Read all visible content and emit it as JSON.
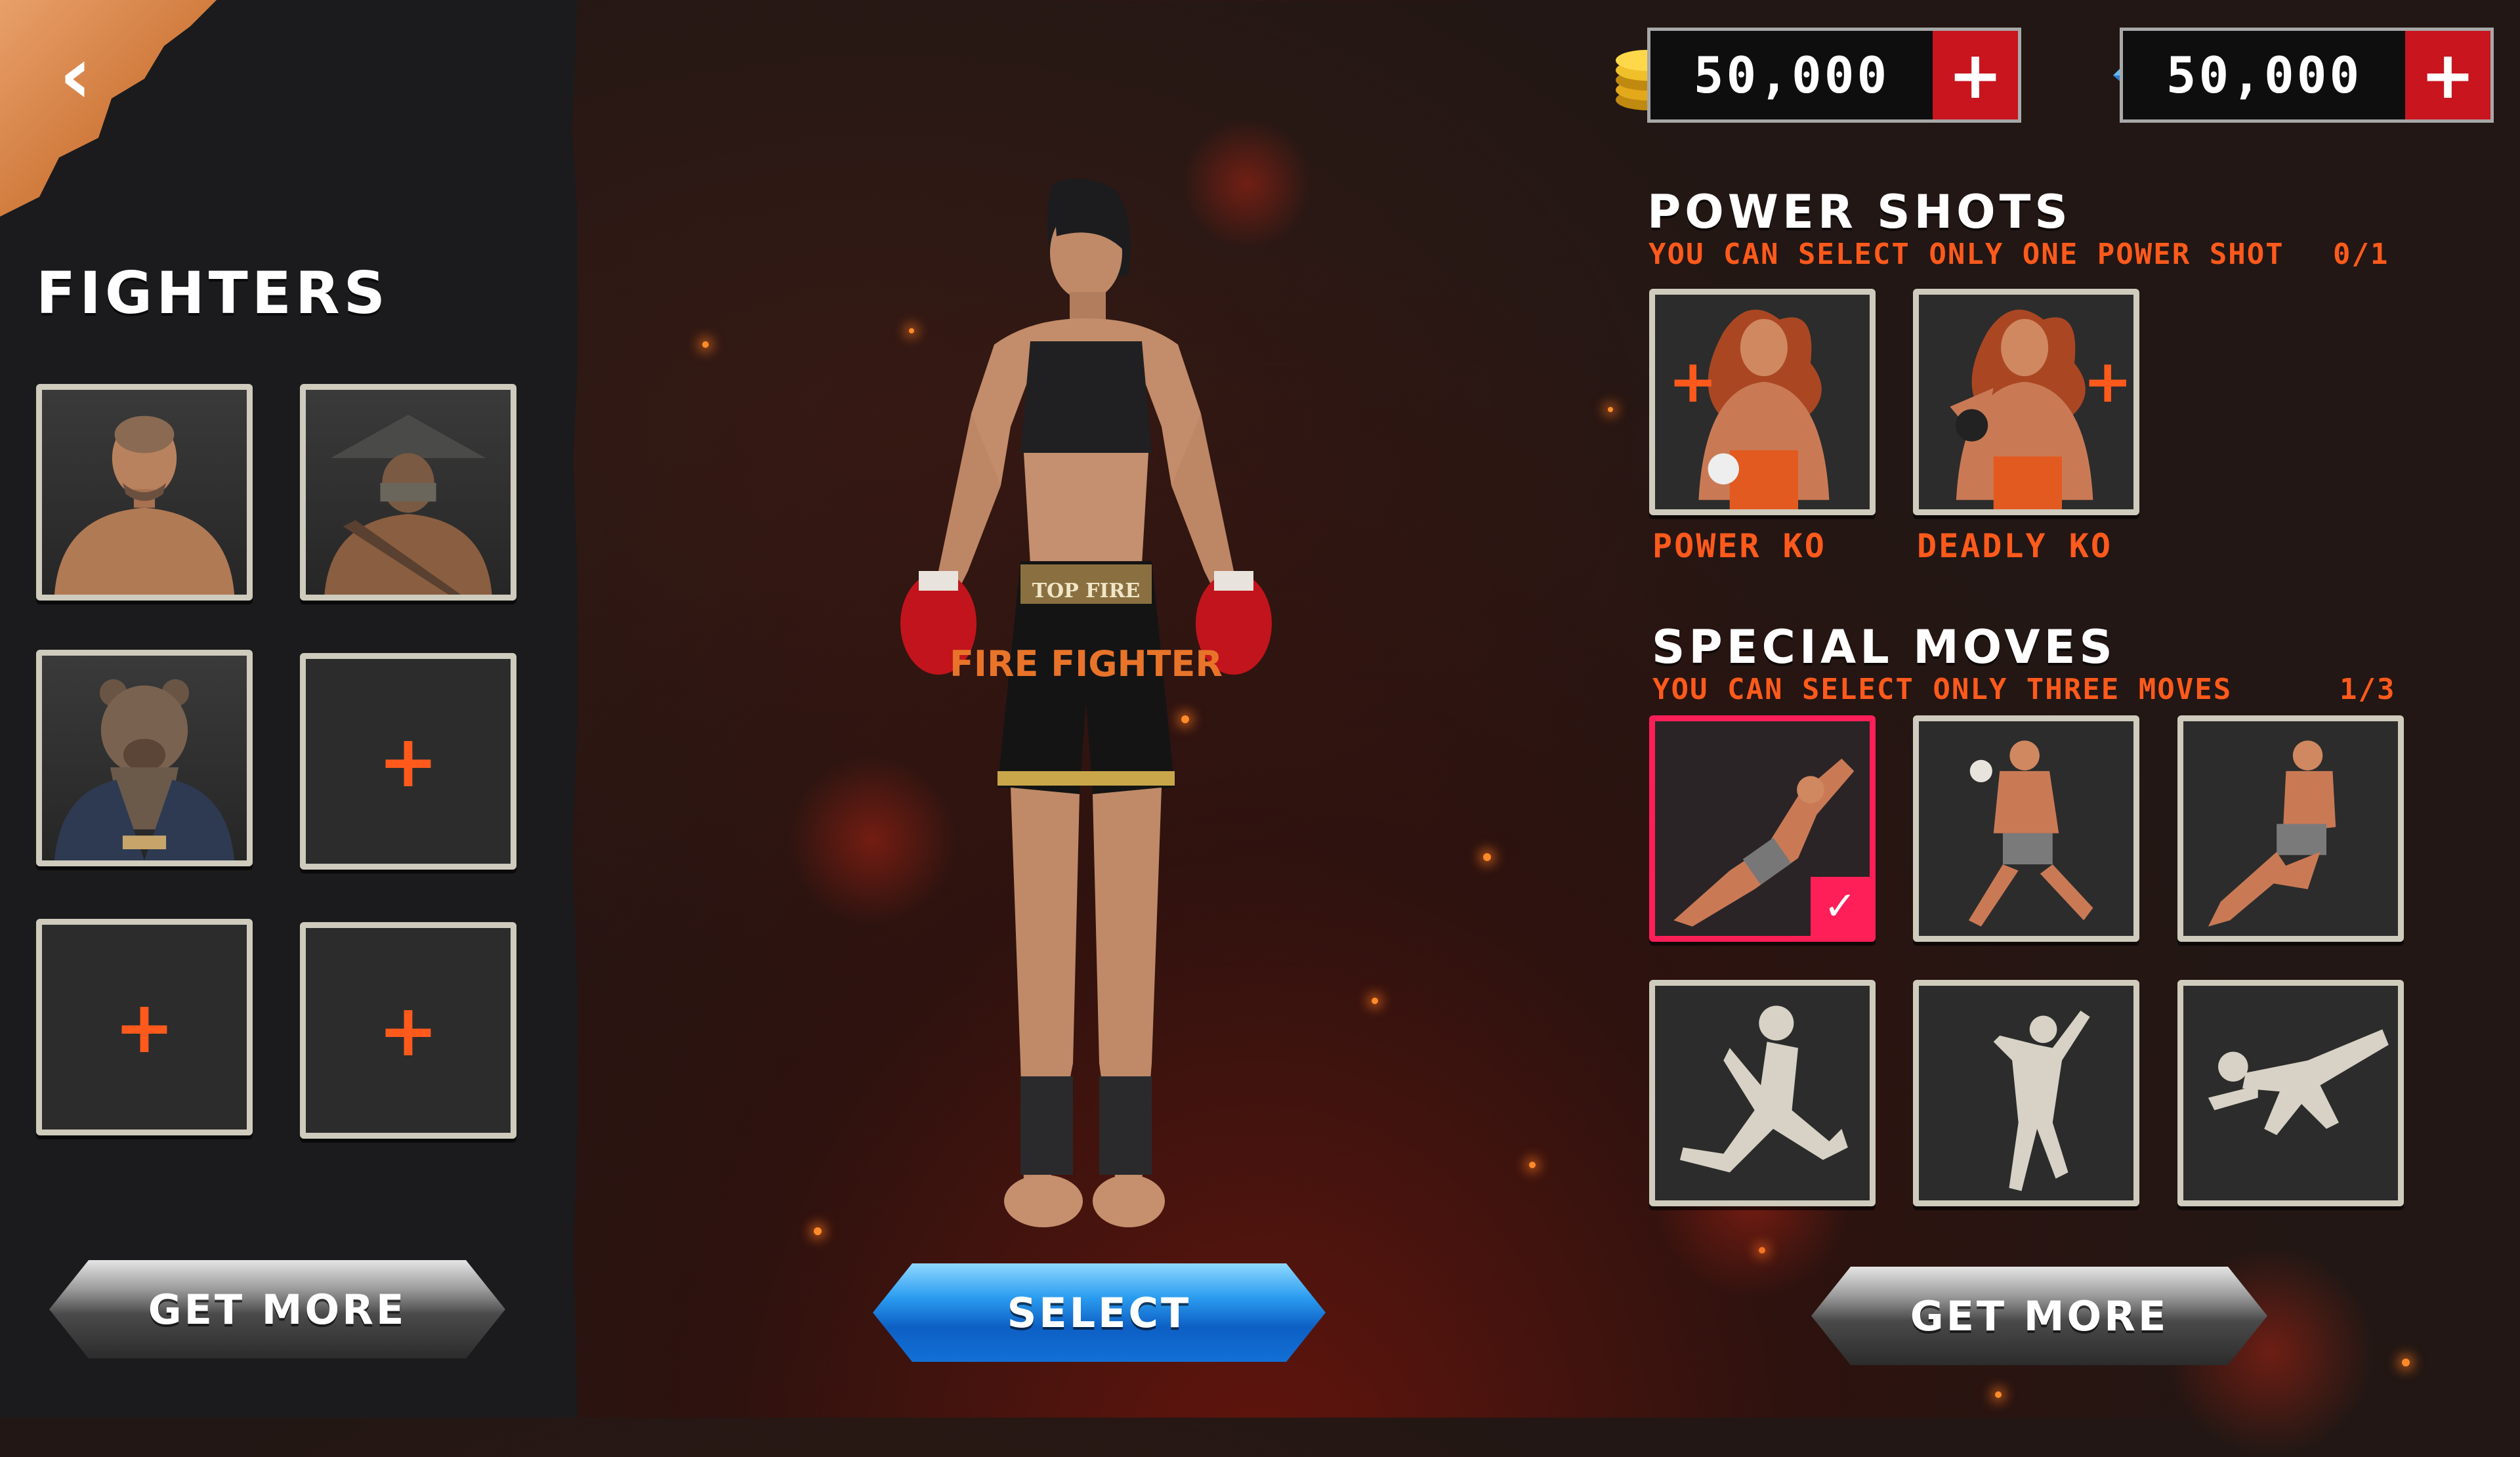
{
  "header": {
    "back_icon": "chevron-left-icon",
    "coins": {
      "icon": "gold-coins-icon",
      "amount": "50,000",
      "add_label": "+"
    },
    "gems": {
      "icon": "blue-gems-icon",
      "amount": "50,000",
      "add_label": "+"
    }
  },
  "fighters_panel": {
    "title": "FIGHTERS",
    "slots": [
      {
        "type": "fighter",
        "icon": "bald-fighter-portrait"
      },
      {
        "type": "fighter",
        "icon": "straw-hat-fighter-portrait"
      },
      {
        "type": "fighter",
        "icon": "bear-mask-fighter-portrait"
      },
      {
        "type": "empty",
        "label": "+"
      },
      {
        "type": "empty",
        "label": "+"
      },
      {
        "type": "empty",
        "label": "+"
      }
    ],
    "get_more_label": "GET MORE"
  },
  "character": {
    "shorts_text_top": "TOP FIRE",
    "shorts_text_main": "FIRE FIGHTER",
    "select_label": "SELECT"
  },
  "power_shots": {
    "title": "POWER SHOTS",
    "subtitle": "YOU CAN SELECT ONLY ONE POWER SHOT",
    "count": "0/1",
    "items": [
      {
        "label": "POWER  KO",
        "icon": "power-ko-icon",
        "plus": "+"
      },
      {
        "label": "DEADLY KO",
        "icon": "deadly-ko-icon",
        "plus": "+"
      }
    ]
  },
  "special_moves": {
    "title": "SPECIAL MOVES",
    "subtitle": "YOU CAN SELECT ONLY THREE MOVES",
    "count": "1/3",
    "check_icon": "check-icon",
    "items": [
      {
        "icon": "flying-punch-move",
        "selected": true,
        "locked": false
      },
      {
        "icon": "guard-stance-move",
        "selected": false,
        "locked": false
      },
      {
        "icon": "jump-knee-move",
        "selected": false,
        "locked": false
      },
      {
        "icon": "locked-silhouette-move-1",
        "selected": false,
        "locked": true
      },
      {
        "icon": "locked-silhouette-move-2",
        "selected": false,
        "locked": true
      },
      {
        "icon": "locked-silhouette-move-3",
        "selected": false,
        "locked": true
      }
    ],
    "get_more_label": "GET MORE"
  },
  "colors": {
    "accent_orange": "#ff5a1c",
    "select_blue": "#1b7fe0",
    "selected_pink": "#ff1f58",
    "add_red": "#c8151e"
  }
}
